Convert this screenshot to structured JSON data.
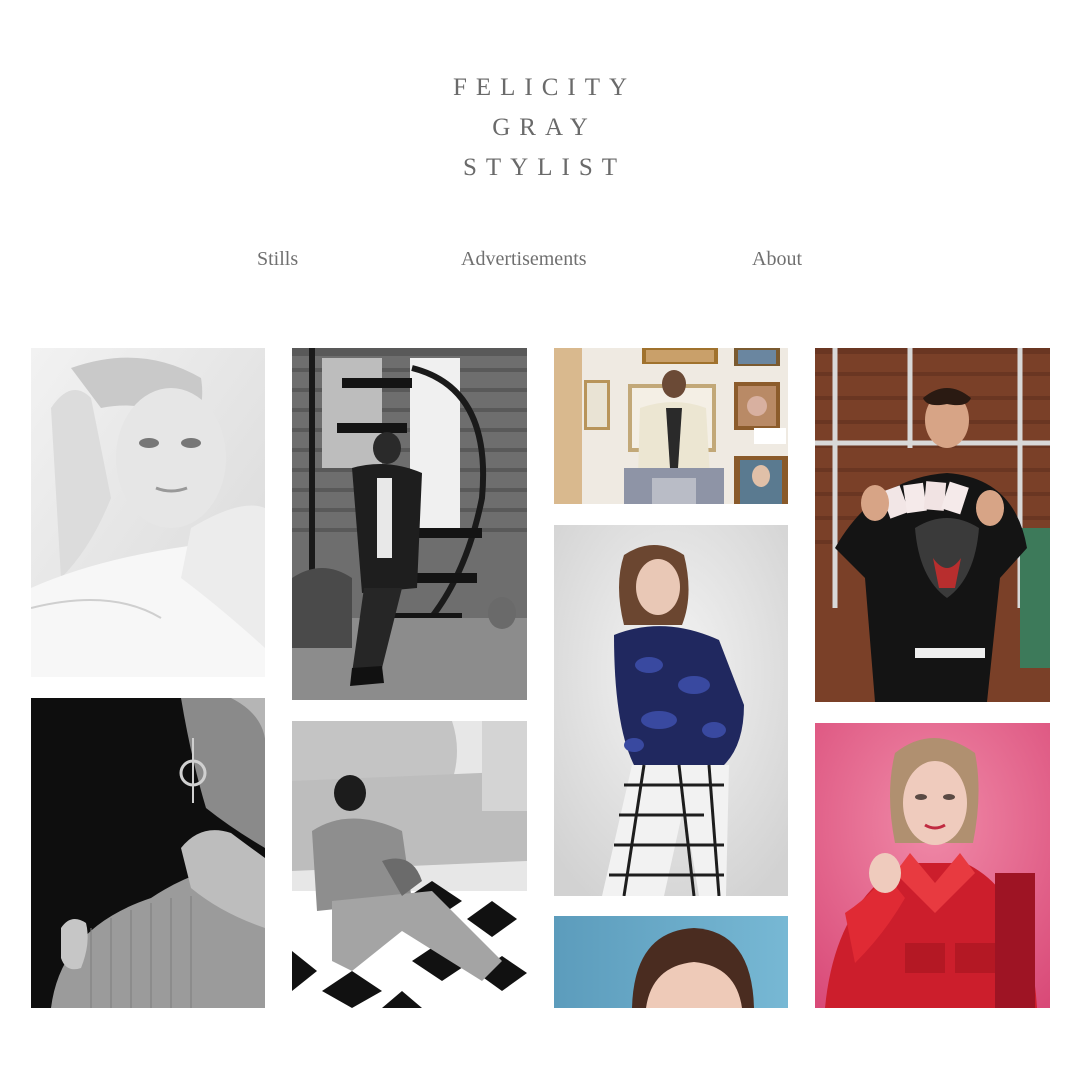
{
  "header": {
    "title_lines": [
      "FELICITY",
      "GRAY",
      "STYLIST"
    ]
  },
  "nav": {
    "items": [
      {
        "label": "Stills"
      },
      {
        "label": "Advertisements"
      },
      {
        "label": "About"
      }
    ]
  },
  "gallery": {
    "tiles": [
      {
        "subject": "black-and-white portrait, blonde woman with hand on head",
        "tone": "monochrome"
      },
      {
        "subject": "black-and-white close-up, neck with ruffled collar and eye earring",
        "tone": "monochrome"
      },
      {
        "subject": "black-and-white, man leaning on spiral staircase",
        "tone": "monochrome"
      },
      {
        "subject": "black-and-white, man seated on geometric patterned rug",
        "tone": "monochrome"
      },
      {
        "subject": "man in cream jacket seated before framed pictures",
        "tone": "color"
      },
      {
        "subject": "woman in blue patterned bomber jacket and check trousers",
        "tone": "color"
      },
      {
        "subject": "woman against blue backdrop, top of head",
        "tone": "color"
      },
      {
        "subject": "man in black sweater holding playing cards",
        "tone": "color"
      },
      {
        "subject": "woman in red jacket against pink backdrop",
        "tone": "color"
      }
    ]
  },
  "colors": {
    "background": "#ffffff",
    "text": "#6b6b6b",
    "accent_pink": "#e45a86",
    "accent_red": "#d3202e",
    "accent_blue": "#2a3a86",
    "accent_teal": "#5fa8c8"
  }
}
